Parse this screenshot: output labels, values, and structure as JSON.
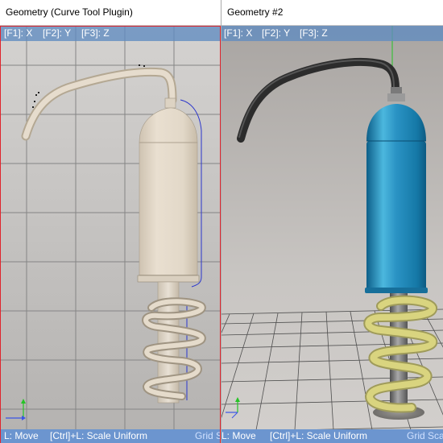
{
  "viewports": {
    "left": {
      "title": "Geometry (Curve Tool Plugin)",
      "axis_x": "[F1]: X",
      "axis_y": "[F2]: Y",
      "axis_z": "[F3]: Z",
      "status_move": "L: Move",
      "status_scale": "[Ctrl]+L: Scale Uniform",
      "status_grid": "Grid S"
    },
    "right": {
      "title": "Geometry #2",
      "axis_x": "[F1]: X",
      "axis_y": "[F2]: Y",
      "axis_z": "[F3]: Z",
      "status_move": "L: Move",
      "status_scale": "[Ctrl]+L: Scale Uniform",
      "status_grid": "Grid Sca"
    }
  },
  "colors": {
    "active_border": "#e0242c",
    "axis_bar": "#608cc0",
    "status_bar": "#6c95cf",
    "model_clay": "#e1d6c6",
    "tank_blue": "#1c7fae",
    "coil_yellow": "#d6d07a",
    "hose_black": "#2a2a2a",
    "axis_x_color": "#3b55e6",
    "axis_y_color": "#26c326"
  }
}
